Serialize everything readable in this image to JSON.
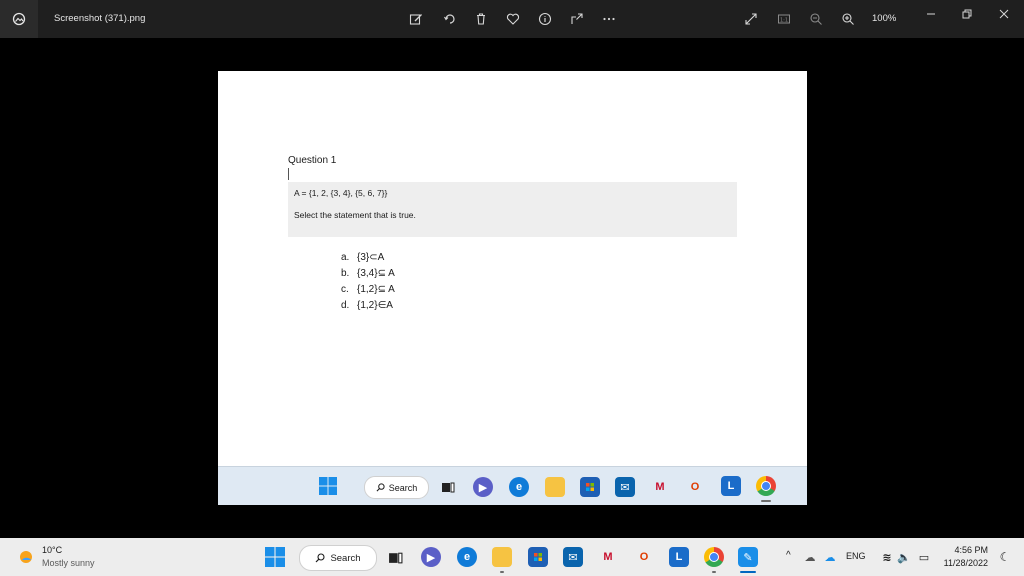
{
  "window": {
    "title": "Screenshot (371).png",
    "zoom": "100%"
  },
  "toolbar": {
    "icons": [
      "edit-image-icon",
      "rotate-icon",
      "delete-icon",
      "favorite-icon",
      "info-icon",
      "share-icon",
      "more-icon",
      "fullscreen-icon",
      "actual-size-icon",
      "zoom-out-icon",
      "zoom-in-icon"
    ]
  },
  "question": {
    "title": "Question 1",
    "set": "A = {1, 2, {3, 4}, {5, 6, 7}}",
    "prompt": "Select the statement that is true.",
    "options": [
      {
        "letter": "a.",
        "text": "{3}⊂A"
      },
      {
        "letter": "b.",
        "text": "{3,4}⊆ A"
      },
      {
        "letter": "c.",
        "text": "{1,2}⊆ A"
      },
      {
        "letter": "d.",
        "text": "{1,2}∈A"
      }
    ]
  },
  "inner_taskbar": {
    "search_label": "Search"
  },
  "taskbar": {
    "weather_temp": "10°C",
    "weather_desc": "Mostly sunny",
    "search_label": "Search",
    "language": "ENG",
    "time": "4:56 PM",
    "date": "11/28/2022"
  },
  "colors": {
    "accent": "#0078d4",
    "taskbar_bg": "#ededed",
    "titlebar_bg": "#1f1f1f"
  }
}
